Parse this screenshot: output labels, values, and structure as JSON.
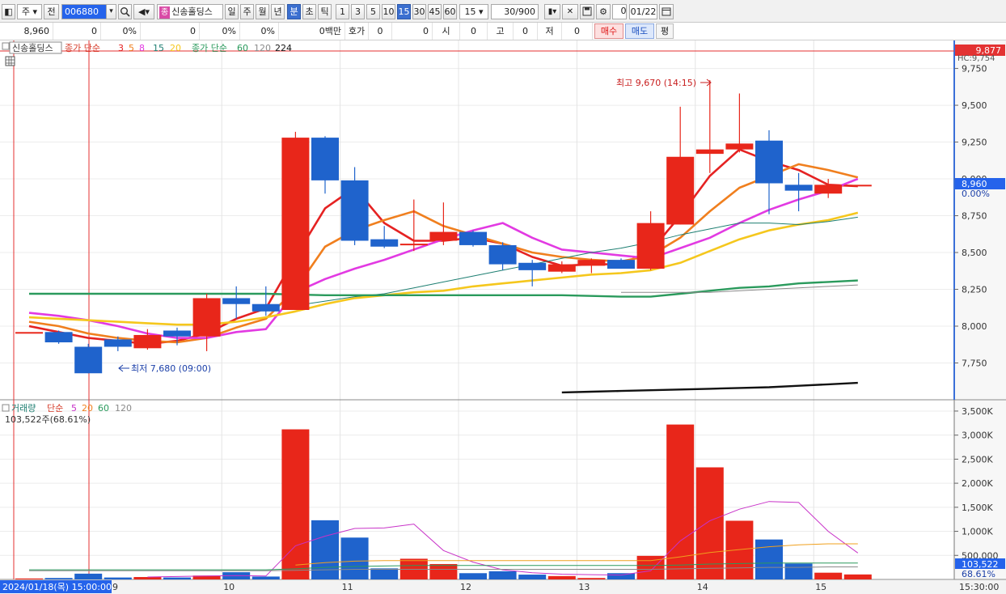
{
  "toolbar": {
    "layout_label": "◧",
    "period_unit": "주",
    "prev_label": "전",
    "code": "006880",
    "stock_name_tag": "종",
    "stock_name": "신송홀딩스",
    "periods": [
      "일",
      "주",
      "월",
      "년",
      "분",
      "초",
      "틱"
    ],
    "active_period": "분",
    "intervals": [
      "1",
      "3",
      "5",
      "10",
      "15",
      "30",
      "45",
      "60"
    ],
    "active_interval": "15",
    "interval_value": "15",
    "count": "30",
    "count_max": "/900",
    "checkbox_label": "0",
    "date": "01/22",
    "icons": [
      "layout-icon",
      "search-icon",
      "speaker-icon",
      "chart-tool-icon",
      "eraser-icon",
      "save-icon",
      "gear-icon",
      "calendar-icon"
    ]
  },
  "quote": {
    "price": "8,960",
    "change": "0",
    "change_rate": "0%",
    "volume": "0",
    "volume_rate": "0%",
    "amount": "0백만",
    "hoga_label": "호가",
    "hoga_value": "0",
    "hoga_qty": "0",
    "open_label": "시",
    "open_value": "0",
    "high_label": "고",
    "high_value": "0",
    "low_label": "저",
    "low_value": "0",
    "buy_label": "매수",
    "sell_label": "매도",
    "avg_label": "평"
  },
  "price_panel": {
    "stock_tag": "신송홀딩스",
    "ma_price_label": "종가 단순",
    "ma_short": [
      "3",
      "5",
      "8",
      "15",
      "20"
    ],
    "ma_price_label2": "종가 단순",
    "ma_long": [
      "60",
      "120",
      "224"
    ],
    "current_price_tag": "9,877",
    "last_price_tag": "8,960",
    "last_rate_tag": "0.00%",
    "hc_tag": "HC:9,754",
    "high_note": "최고 9,670 (14:15)",
    "low_note": "최저 7,680 (09:00)"
  },
  "volume_panel": {
    "title": "거래량",
    "ma_label": "단순",
    "ma_periods": [
      "5",
      "20",
      "60",
      "120"
    ],
    "summary": "103,522주(68.61%)",
    "last_volume_tag": "103,522",
    "last_rate_tag": "68.61%"
  },
  "time_axis": {
    "start_label": "2024/01/18(목) 15:00:00",
    "day_labels": [
      "9",
      "10",
      "11",
      "12",
      "13",
      "14",
      "15"
    ],
    "end_label": "15:30:00"
  },
  "colors": {
    "up": "#e8261a",
    "down": "#1f63cc",
    "ma3": "#e52222",
    "ma5": "#f07f1e",
    "ma8": "#e23ae2",
    "ma15": "#f5c71d",
    "ma20": "#1e7f72",
    "ma60": "#2a9a5c",
    "ma120": "#8a8a8a",
    "ma224": "#111111"
  },
  "chart_data": {
    "type": "candlestick",
    "price_axis": {
      "ticks": [
        7750,
        8000,
        8250,
        8500,
        8750,
        9000,
        9250,
        9500,
        9750
      ],
      "labels": [
        "7,750",
        "8,000",
        "8,250",
        "8,500",
        "8,750",
        "9,000",
        "9,250",
        "9,500",
        "9,750"
      ],
      "range": [
        7500,
        9940
      ]
    },
    "volume_axis": {
      "ticks": [
        500000,
        1000000,
        1500000,
        2000000,
        2500000,
        3000000,
        3500000
      ],
      "labels": [
        "500,000",
        "1,000K",
        "1,500K",
        "2,000K",
        "2,500K",
        "3,000K",
        "3,500K"
      ],
      "range": [
        0,
        3600000
      ]
    },
    "candles": [
      {
        "o": 7960,
        "h": 7960,
        "l": 7960,
        "c": 7960,
        "v": 20000
      },
      {
        "o": 7960,
        "h": 7970,
        "l": 7880,
        "c": 7890,
        "v": 30000
      },
      {
        "o": 7860,
        "h": 7880,
        "l": 7680,
        "c": 7680,
        "v": 120000
      },
      {
        "o": 7910,
        "h": 7930,
        "l": 7830,
        "c": 7860,
        "v": 40000
      },
      {
        "o": 7850,
        "h": 7980,
        "l": 7840,
        "c": 7940,
        "v": 50000
      },
      {
        "o": 7970,
        "h": 7990,
        "l": 7870,
        "c": 7930,
        "v": 40000
      },
      {
        "o": 7930,
        "h": 8220,
        "l": 7830,
        "c": 8190,
        "v": 80000
      },
      {
        "o": 8190,
        "h": 8270,
        "l": 8050,
        "c": 8150,
        "v": 150000
      },
      {
        "o": 8150,
        "h": 8270,
        "l": 8070,
        "c": 8100,
        "v": 60000
      },
      {
        "o": 8110,
        "h": 9320,
        "l": 8110,
        "c": 9280,
        "v": 3120000
      },
      {
        "o": 9280,
        "h": 9290,
        "l": 8900,
        "c": 8990,
        "v": 1230000
      },
      {
        "o": 8990,
        "h": 9080,
        "l": 8550,
        "c": 8580,
        "v": 870000
      },
      {
        "o": 8590,
        "h": 8680,
        "l": 8530,
        "c": 8540,
        "v": 230000
      },
      {
        "o": 8560,
        "h": 8860,
        "l": 8510,
        "c": 8560,
        "v": 430000
      },
      {
        "o": 8580,
        "h": 8840,
        "l": 8550,
        "c": 8640,
        "v": 320000
      },
      {
        "o": 8640,
        "h": 8650,
        "l": 8540,
        "c": 8550,
        "v": 130000
      },
      {
        "o": 8550,
        "h": 8570,
        "l": 8380,
        "c": 8420,
        "v": 170000
      },
      {
        "o": 8430,
        "h": 8450,
        "l": 8270,
        "c": 8380,
        "v": 100000
      },
      {
        "o": 8370,
        "h": 8440,
        "l": 8360,
        "c": 8420,
        "v": 70000
      },
      {
        "o": 8410,
        "h": 8460,
        "l": 8360,
        "c": 8450,
        "v": 30000
      },
      {
        "o": 8450,
        "h": 8460,
        "l": 8390,
        "c": 8390,
        "v": 130000
      },
      {
        "o": 8390,
        "h": 8780,
        "l": 8380,
        "c": 8700,
        "v": 490000
      },
      {
        "o": 8690,
        "h": 9490,
        "l": 8690,
        "c": 9150,
        "v": 3220000
      },
      {
        "o": 9170,
        "h": 9670,
        "l": 9040,
        "c": 9200,
        "v": 2330000
      },
      {
        "o": 9200,
        "h": 9580,
        "l": 9180,
        "c": 9240,
        "v": 1220000
      },
      {
        "o": 9260,
        "h": 9330,
        "l": 8760,
        "c": 8970,
        "v": 830000
      },
      {
        "o": 8960,
        "h": 9040,
        "l": 8780,
        "c": 8920,
        "v": 330000
      },
      {
        "o": 8900,
        "h": 9000,
        "l": 8870,
        "c": 8960,
        "v": 140000
      },
      {
        "o": 8960,
        "h": 8960,
        "l": 8960,
        "c": 8960,
        "v": 103522
      }
    ],
    "ma_series": [
      {
        "name": "3",
        "values": [
          8000,
          7960,
          7920,
          7900,
          7880,
          7900,
          7950,
          8050,
          8120,
          8470,
          8800,
          8940,
          8700,
          8580,
          8580,
          8600,
          8560,
          8470,
          8410,
          8420,
          8420,
          8510,
          8750,
          9020,
          9200,
          9120,
          9060,
          8960,
          8950
        ]
      },
      {
        "name": "5",
        "values": [
          8030,
          8000,
          7950,
          7920,
          7900,
          7890,
          7920,
          7990,
          8050,
          8250,
          8540,
          8650,
          8720,
          8780,
          8680,
          8620,
          8560,
          8500,
          8470,
          8450,
          8440,
          8480,
          8600,
          8780,
          8940,
          9020,
          9100,
          9060,
          9010
        ]
      },
      {
        "name": "8",
        "values": [
          8090,
          8070,
          8040,
          8000,
          7950,
          7920,
          7920,
          7960,
          7980,
          8230,
          8320,
          8390,
          8450,
          8520,
          8590,
          8650,
          8700,
          8600,
          8520,
          8500,
          8480,
          8460,
          8530,
          8600,
          8700,
          8790,
          8860,
          8920,
          9000
        ]
      },
      {
        "name": "15",
        "values": [
          8060,
          8050,
          8040,
          8030,
          8020,
          8010,
          8010,
          8030,
          8060,
          8100,
          8150,
          8190,
          8210,
          8230,
          8240,
          8270,
          8290,
          8310,
          8330,
          8350,
          8360,
          8380,
          8430,
          8510,
          8590,
          8650,
          8690,
          8720,
          8770
        ]
      },
      {
        "name": "20",
        "values": [
          null,
          null,
          null,
          null,
          null,
          null,
          null,
          null,
          null,
          8140,
          8170,
          8200,
          8220,
          8260,
          8300,
          8340,
          8380,
          8420,
          8460,
          8500,
          8530,
          8570,
          8620,
          8660,
          8700,
          8700,
          8690,
          8710,
          8740
        ]
      },
      {
        "name": "60",
        "values": [
          8220,
          8220,
          8220,
          8220,
          8220,
          8220,
          8220,
          8220,
          8220,
          8215,
          8210,
          8210,
          8210,
          8210,
          8210,
          8210,
          8210,
          8210,
          8210,
          8205,
          8200,
          8200,
          8220,
          8240,
          8260,
          8270,
          8290,
          8300,
          8310
        ]
      },
      {
        "name": "120",
        "values": [
          null,
          null,
          null,
          null,
          null,
          null,
          null,
          null,
          null,
          null,
          null,
          null,
          null,
          null,
          null,
          null,
          null,
          null,
          null,
          null,
          8230,
          8230,
          8230,
          8230,
          8240,
          8250,
          8260,
          8270,
          8280
        ]
      },
      {
        "name": "224",
        "values": [
          null,
          null,
          null,
          null,
          null,
          null,
          null,
          null,
          null,
          null,
          null,
          null,
          null,
          null,
          null,
          null,
          null,
          null,
          7550,
          7555,
          7560,
          7565,
          7570,
          7575,
          7580,
          7585,
          7595,
          7605,
          7615
        ]
      }
    ],
    "volume_ma_series": [
      {
        "name": "5",
        "values": [
          null,
          null,
          null,
          null,
          50000,
          60000,
          70000,
          80000,
          70000,
          700000,
          900000,
          1060000,
          1070000,
          1150000,
          600000,
          360000,
          200000,
          140000,
          110000,
          100000,
          90000,
          180000,
          800000,
          1220000,
          1460000,
          1620000,
          1600000,
          1000000,
          550000
        ]
      },
      {
        "name": "20",
        "values": [
          null,
          null,
          null,
          null,
          null,
          null,
          null,
          null,
          null,
          300000,
          350000,
          380000,
          390000,
          390000,
          390000,
          390000,
          390000,
          390000,
          390000,
          390000,
          390000,
          390000,
          470000,
          560000,
          620000,
          680000,
          720000,
          740000,
          740000
        ]
      },
      {
        "name": "60",
        "values": [
          200000,
          200000,
          200000,
          200000,
          200000,
          200000,
          200000,
          200000,
          200000,
          220000,
          250000,
          270000,
          280000,
          290000,
          290000,
          290000,
          290000,
          290000,
          290000,
          290000,
          290000,
          290000,
          300000,
          320000,
          330000,
          340000,
          340000,
          340000,
          340000
        ]
      },
      {
        "name": "120",
        "values": [
          180000,
          180000,
          180000,
          180000,
          180000,
          180000,
          180000,
          180000,
          180000,
          190000,
          200000,
          210000,
          210000,
          210000,
          210000,
          210000,
          210000,
          210000,
          210000,
          210000,
          210000,
          210000,
          220000,
          230000,
          240000,
          250000,
          250000,
          260000,
          260000
        ]
      }
    ]
  }
}
